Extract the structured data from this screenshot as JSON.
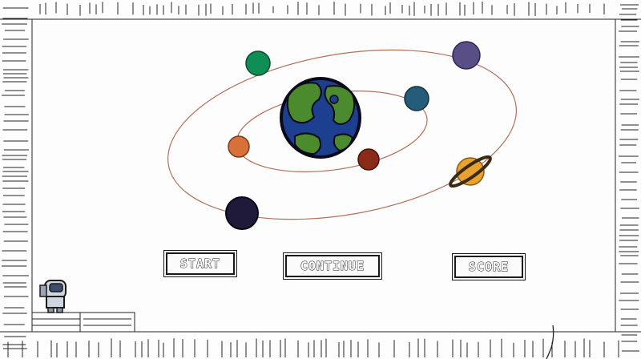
{
  "menu": {
    "start_label": "START",
    "continue_label": "CONTINUE",
    "score_label": "SCORE"
  },
  "colors": {
    "background": "#fdfdfd",
    "ink": "#1a1a1a",
    "orbit": "#b0705a",
    "earth_ocean": "#1d3f8f",
    "earth_land": "#4c8a2e",
    "planet_green": "#0f8f55",
    "planet_purple": "#5a4e86",
    "planet_teal": "#245c7a",
    "planet_orange": "#d8703a",
    "planet_red": "#8a2b1a",
    "planet_saturn": "#e8a230",
    "planet_dark": "#1f1a3a"
  },
  "icons": [
    "astronaut-icon",
    "earth-icon",
    "saturn-icon"
  ]
}
